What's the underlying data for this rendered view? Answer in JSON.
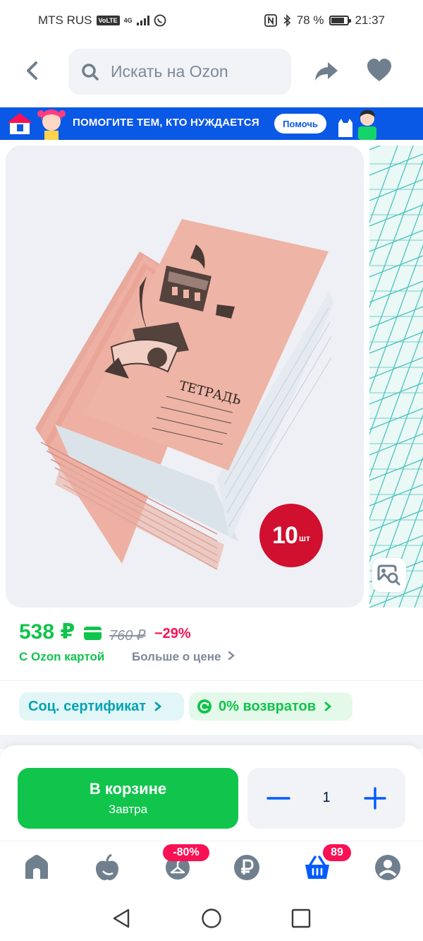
{
  "status_bar": {
    "carrier": "MTS RUS",
    "volte": "VoLTE",
    "network": "4G",
    "battery": "78 %",
    "time": "21:37"
  },
  "header": {
    "search_placeholder": "Искать на Ozon"
  },
  "banner": {
    "text": "ПОМОГИТЕ ТЕМ, КТО НУЖДАЕТСЯ",
    "button": "Помочь"
  },
  "gallery": {
    "badge_number": "10",
    "badge_unit": "шт",
    "cover_title": "ТЕТРАДЬ"
  },
  "price": {
    "current": "538 ₽",
    "old": "760 ₽",
    "discount": "−29%",
    "card_note": "С Ozon картой",
    "more": "Больше о цене"
  },
  "chips": {
    "certificate": "Соц. сертификат",
    "returns": "0% возвратов"
  },
  "action": {
    "cart_label": "В корзине",
    "delivery": "Завтра",
    "quantity": "1"
  },
  "tabbar": {
    "promo_badge": "-80%",
    "cart_badge": "89",
    "active_color": "#005bff"
  },
  "colors": {
    "ozon_green": "#10c44c",
    "ozon_blue": "#005bff",
    "discount_pink": "#f91155"
  }
}
